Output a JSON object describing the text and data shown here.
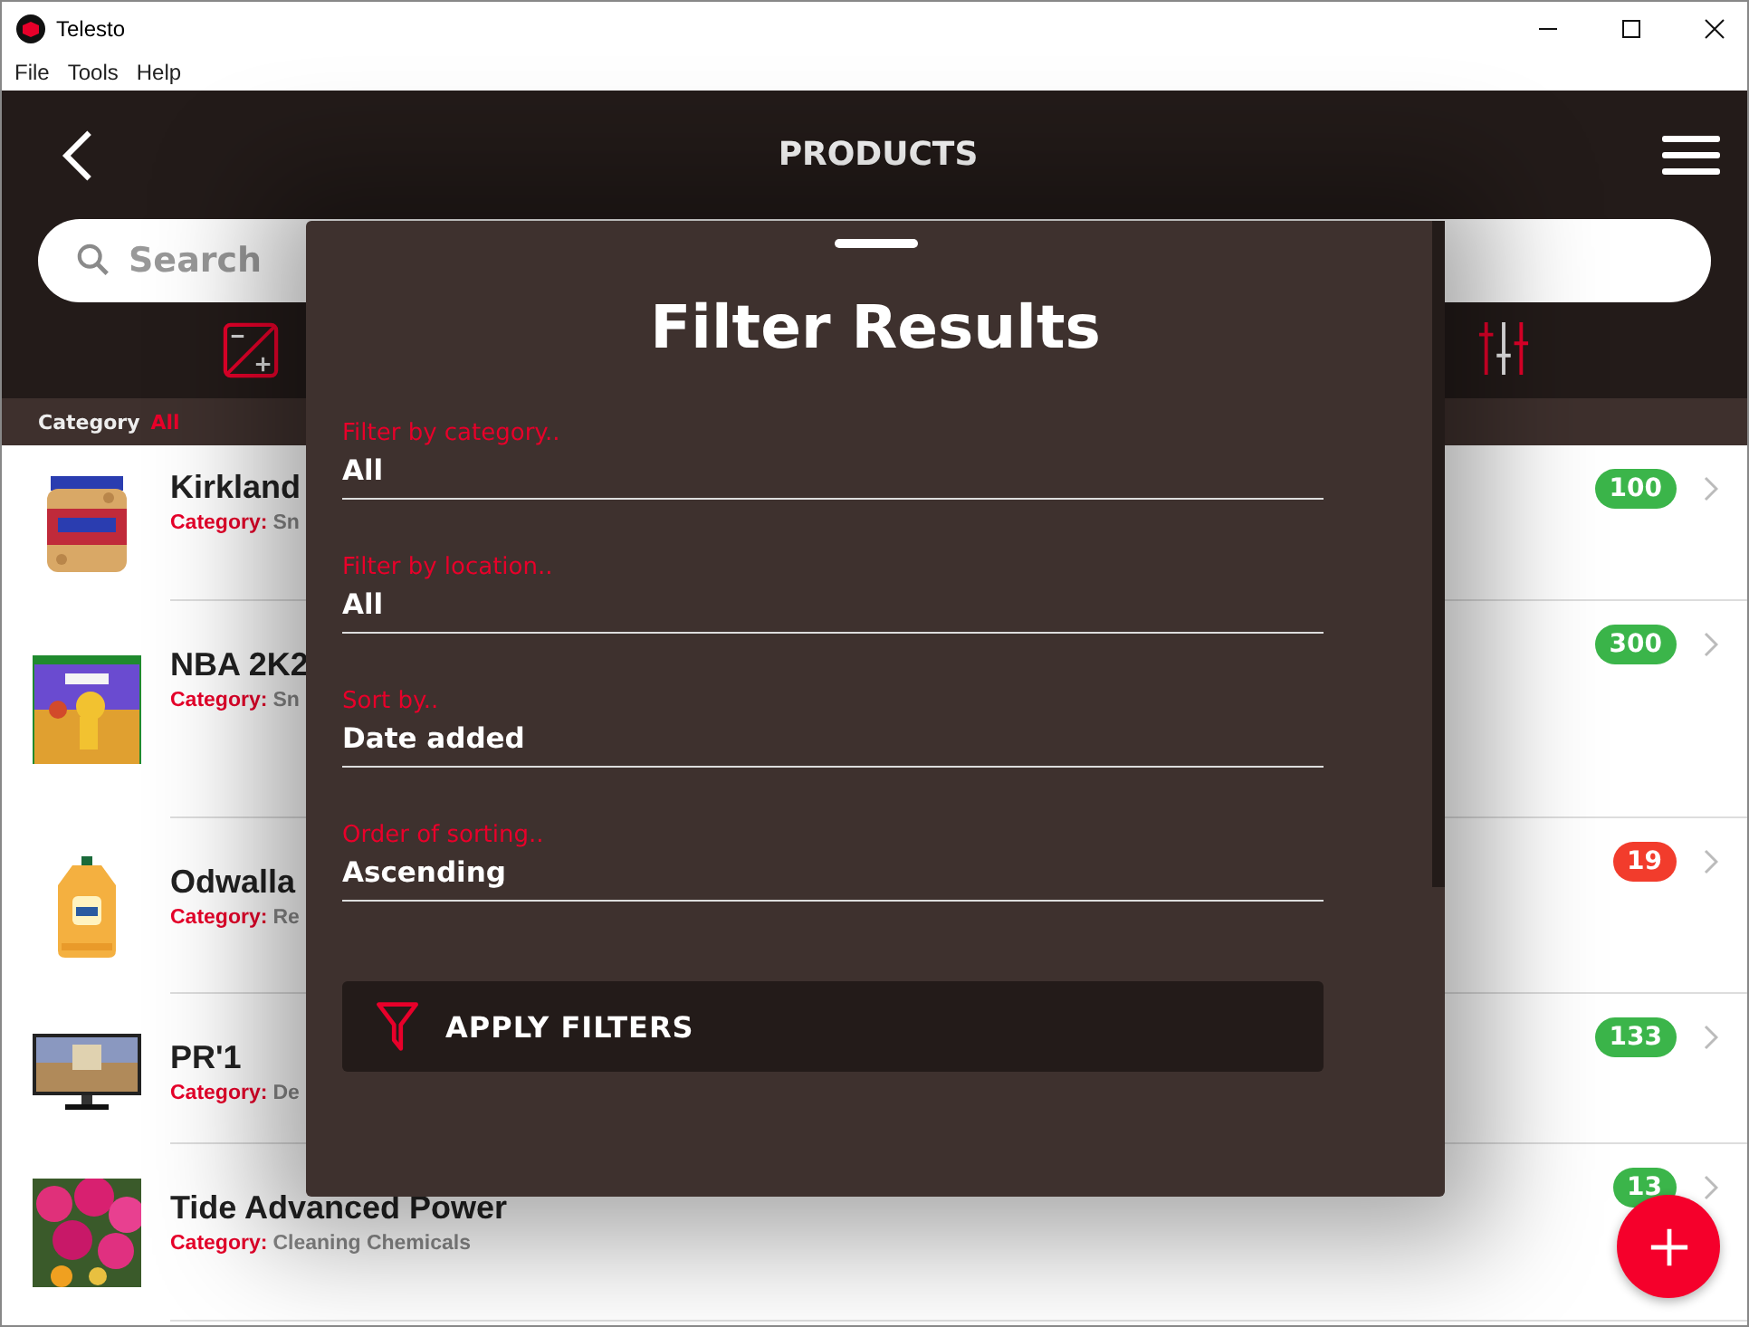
{
  "window": {
    "title": "Telesto"
  },
  "menu": [
    "File",
    "Tools",
    "Help"
  ],
  "header": {
    "title": "PRODUCTS"
  },
  "search": {
    "placeholder": "Search"
  },
  "category_bar": {
    "label": "Category",
    "value": "All"
  },
  "products": [
    {
      "name": "Kirkland",
      "category_label": "Category:",
      "category": "Sn",
      "count": "100",
      "color": "#3bb54a"
    },
    {
      "name": "NBA 2K2",
      "category_label": "Category:",
      "category": "Sn",
      "count": "300",
      "color": "#3bb54a"
    },
    {
      "name": "Odwalla",
      "category_label": "Category:",
      "category": "Re",
      "count": "19",
      "color": "#f23c2c"
    },
    {
      "name": "PR'1",
      "category_label": "Category:",
      "category": "De",
      "count": "133",
      "color": "#3bb54a"
    },
    {
      "name": "Tide Advanced Power",
      "category_label": "Category:",
      "category": "Cleaning Chemicals",
      "count": "13",
      "color": "#3bb54a"
    }
  ],
  "filter_panel": {
    "title": "Filter Results",
    "fields": [
      {
        "label": "Filter by category..",
        "value": "All"
      },
      {
        "label": "Filter by location..",
        "value": "All"
      },
      {
        "label": "Sort by..",
        "value": "Date added"
      },
      {
        "label": "Order of sorting..",
        "value": "Ascending"
      }
    ],
    "apply_button": "APPLY FILTERS"
  }
}
